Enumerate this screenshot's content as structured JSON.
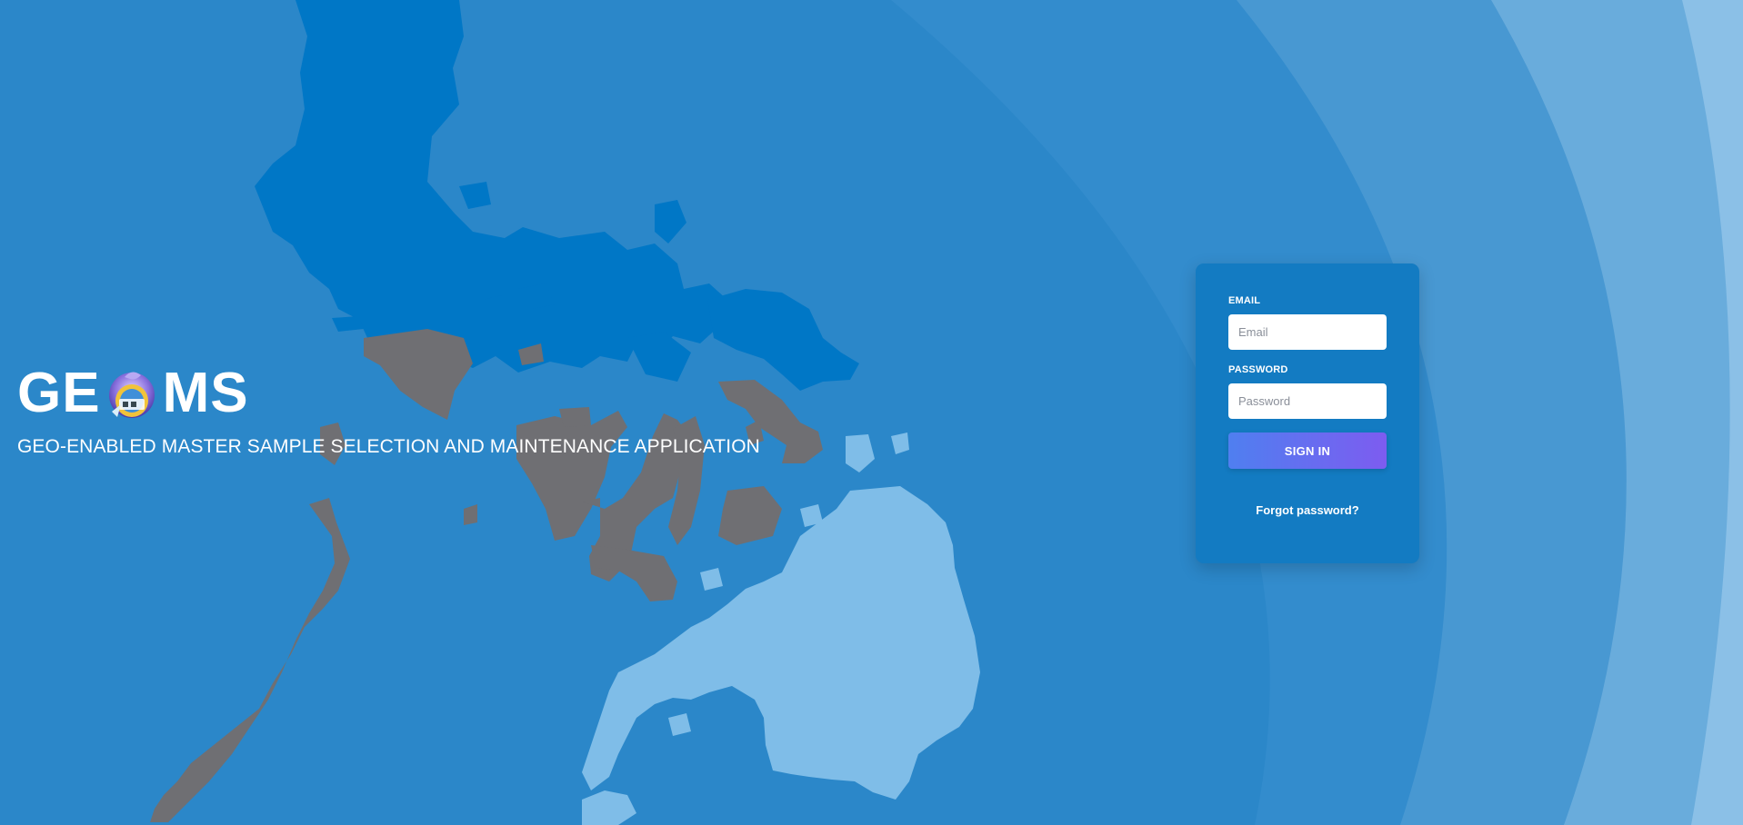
{
  "brand": {
    "title_left": "GE",
    "title_right": "MS",
    "logo_icon": "geo-globe-logo-icon",
    "subtitle": "GEO-ENABLED MASTER SAMPLE SELECTION AND MAINTENANCE APPLICATION"
  },
  "login": {
    "email_label": "EMAIL",
    "email_placeholder": "Email",
    "email_value": "",
    "password_label": "PASSWORD",
    "password_placeholder": "Password",
    "password_value": "",
    "signin_label": "SIGN IN",
    "forgot_label": "Forgot password?"
  },
  "colors": {
    "background": "#2b87c9",
    "luzon": "#0077c6",
    "visayas": "#6f6f73",
    "mindanao": "#7fbde8",
    "card": "#137bc2",
    "button_start": "#4f7ff0",
    "button_end": "#7d5cf0"
  }
}
